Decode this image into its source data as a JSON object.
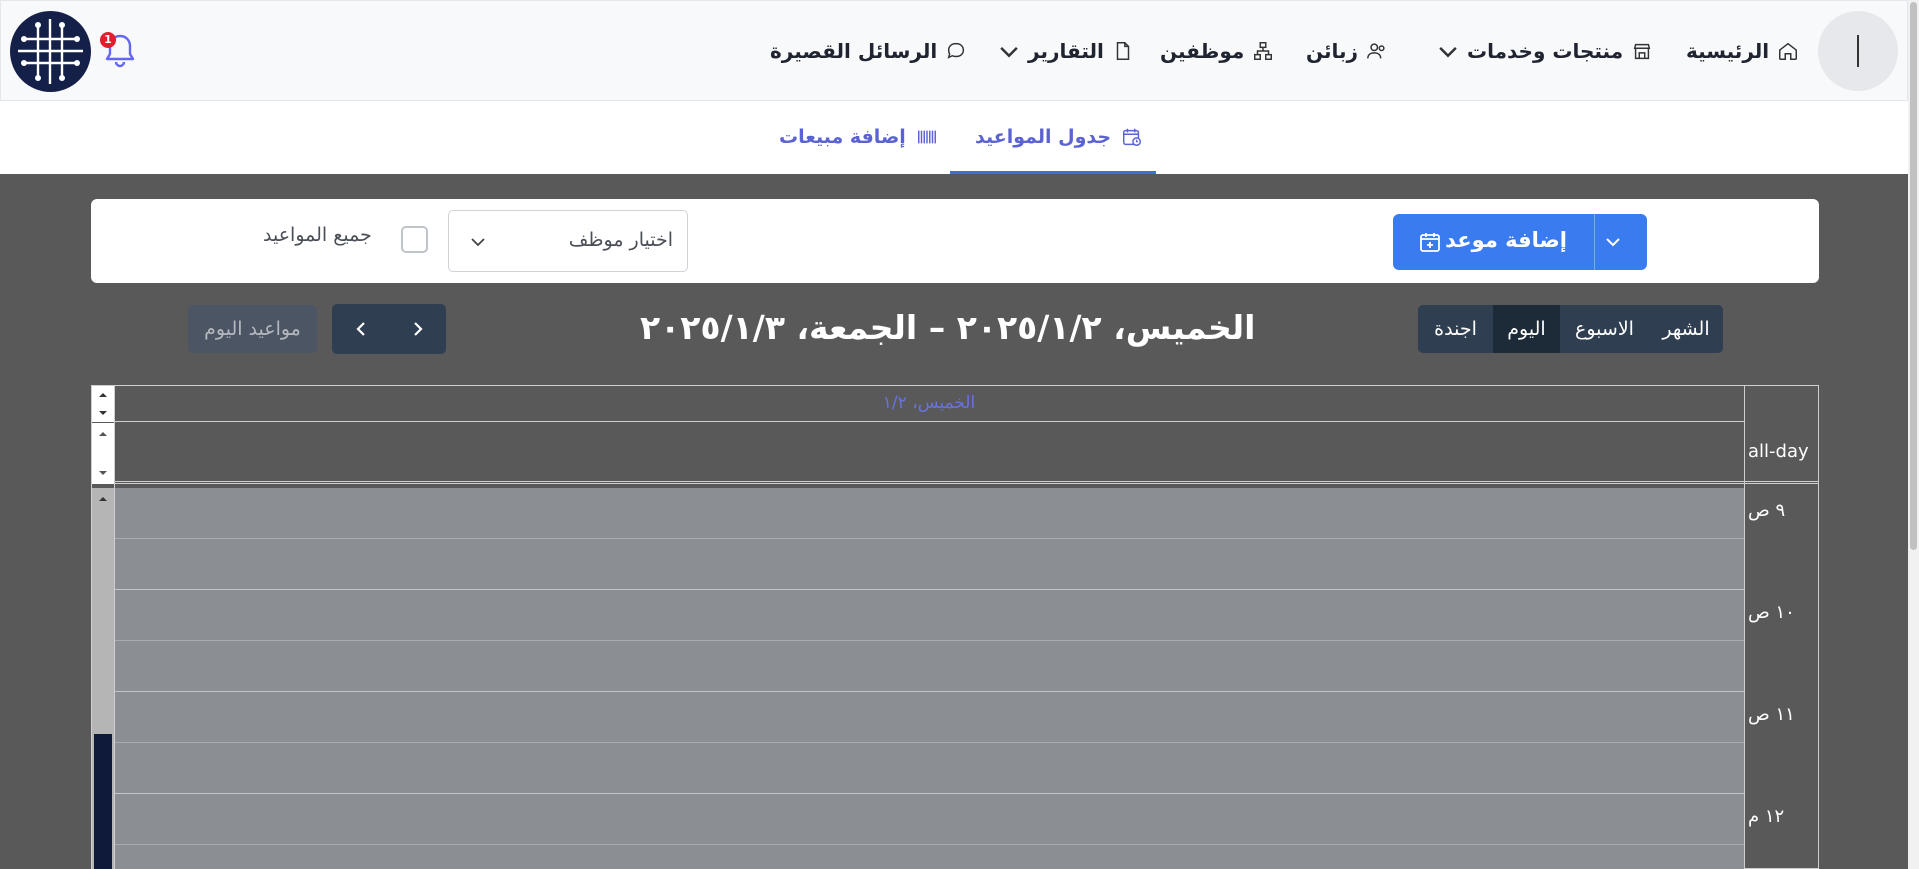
{
  "nav": {
    "home": "الرئيسية",
    "products": "منتجات وخدمات",
    "customers": "زبائن",
    "employees": "موظفين",
    "reports": "التقارير",
    "sms": "الرسائل القصيرة",
    "notification_count": "1"
  },
  "tabs": {
    "schedule": "جدول المواعيد",
    "add_sales": "إضافة مبيعات"
  },
  "toolbar": {
    "add_appointment": "إضافة موعد",
    "employee_select_value": "اختيار موظف",
    "all_appointments_label": "جميع المواعيد"
  },
  "calendar": {
    "views": [
      "الشهر",
      "الاسبوع",
      "اليوم",
      "اجندة"
    ],
    "active_view": "اليوم",
    "title": "الخميس، ٢٠٢٥/١/٢ – الجمعة، ٢٠٢٥/١/٣",
    "today_button": "مواعيد اليوم",
    "day_header": "الخميس، ١/٢",
    "allday_label": "all-day",
    "time_labels": [
      "٩ ص",
      "١٠ ص",
      "١١ ص",
      "١٢ م"
    ]
  },
  "colors": {
    "accent": "#3a7bf0",
    "tab_text": "#5b63d3",
    "calendar_bg": "#595959",
    "slot_bg": "#8b8e92",
    "dark_button": "#2f3e50"
  }
}
